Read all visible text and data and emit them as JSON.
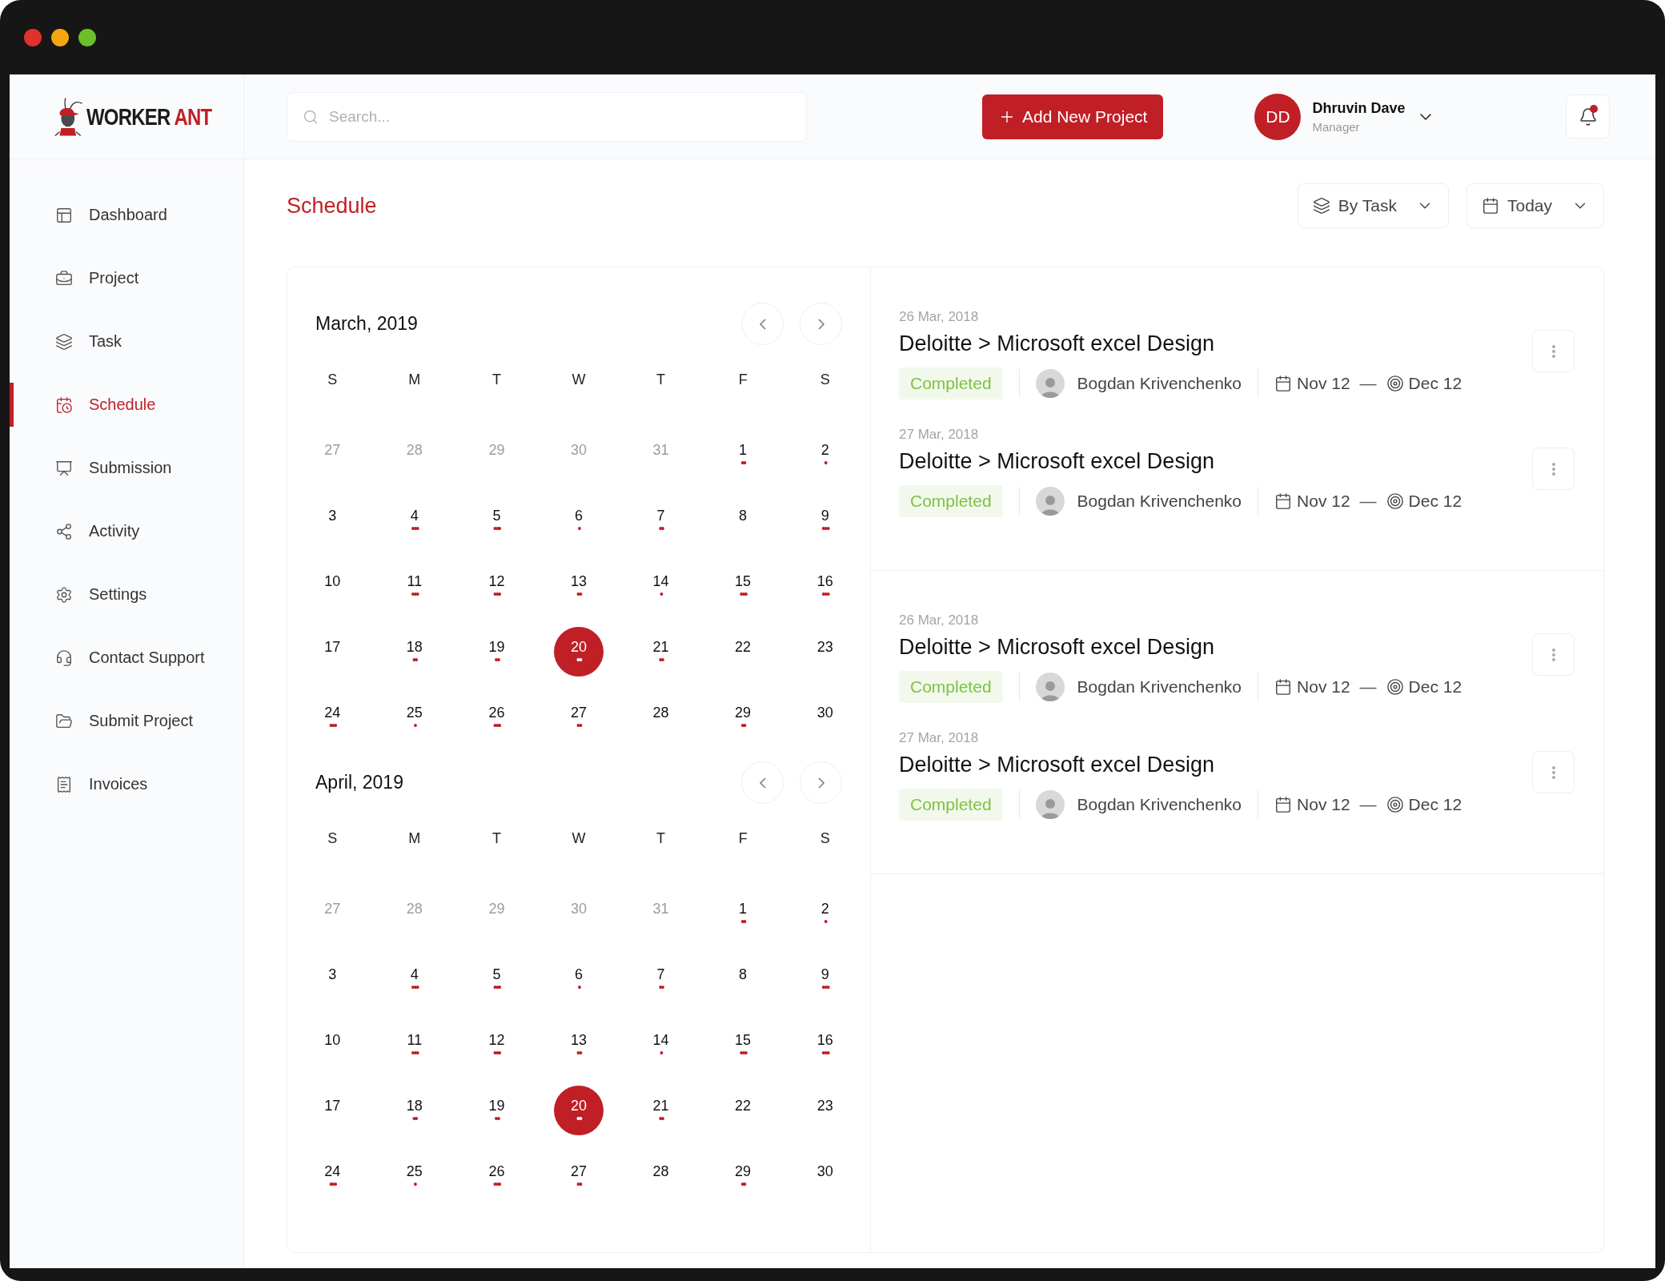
{
  "brand": {
    "word_1": "WORKER",
    "word_2": "ANT"
  },
  "search": {
    "placeholder": "Search..."
  },
  "add_button": {
    "label": "Add New Project"
  },
  "user": {
    "initials": "DD",
    "name": "Dhruvin Dave",
    "role": "Manager"
  },
  "notifications": {
    "unread": true
  },
  "sidebar": {
    "items": [
      {
        "label": "Dashboard",
        "selected": false
      },
      {
        "label": "Project",
        "selected": false
      },
      {
        "label": "Task",
        "selected": false
      },
      {
        "label": "Schedule",
        "selected": true
      },
      {
        "label": "Submission",
        "selected": false
      },
      {
        "label": "Activity",
        "selected": false
      },
      {
        "label": "Settings",
        "selected": false
      },
      {
        "label": "Contact Support",
        "selected": false
      },
      {
        "label": "Submit Project",
        "selected": false
      },
      {
        "label": "Invoices",
        "selected": false
      }
    ]
  },
  "page": {
    "title": "Schedule",
    "filters": [
      {
        "label": "By Task"
      },
      {
        "label": "Today"
      }
    ]
  },
  "calendars": [
    {
      "title": "March, 2019",
      "weekdays": [
        "S",
        "M",
        "T",
        "W",
        "T",
        "F",
        "S"
      ],
      "days": [
        {
          "day": "27",
          "muted": true,
          "selected": false
        },
        {
          "day": "28",
          "muted": true,
          "selected": false
        },
        {
          "day": "29",
          "muted": true,
          "selected": false
        },
        {
          "day": "30",
          "muted": true,
          "selected": false
        },
        {
          "day": "31",
          "muted": true,
          "selected": false
        },
        {
          "day": "1",
          "muted": false,
          "selected": false,
          "dots": "••"
        },
        {
          "day": "2",
          "muted": false,
          "selected": false,
          "dots": "•"
        },
        {
          "day": "3",
          "muted": false,
          "selected": false
        },
        {
          "day": "4",
          "muted": false,
          "selected": false,
          "dots": "•••"
        },
        {
          "day": "5",
          "muted": false,
          "selected": false,
          "dots": "•••"
        },
        {
          "day": "6",
          "muted": false,
          "selected": false,
          "dots": "•"
        },
        {
          "day": "7",
          "muted": false,
          "selected": false,
          "dots": "••"
        },
        {
          "day": "8",
          "muted": false,
          "selected": false
        },
        {
          "day": "9",
          "muted": false,
          "selected": false,
          "dots": "•••"
        },
        {
          "day": "10",
          "muted": false,
          "selected": false
        },
        {
          "day": "11",
          "muted": false,
          "selected": false,
          "dots": "•••"
        },
        {
          "day": "12",
          "muted": false,
          "selected": false,
          "dots": "•••"
        },
        {
          "day": "13",
          "muted": false,
          "selected": false,
          "dots": "••"
        },
        {
          "day": "14",
          "muted": false,
          "selected": false,
          "dots": "•"
        },
        {
          "day": "15",
          "muted": false,
          "selected": false,
          "dots": "•••"
        },
        {
          "day": "16",
          "muted": false,
          "selected": false,
          "dots": "•••"
        },
        {
          "day": "17",
          "muted": false,
          "selected": false
        },
        {
          "day": "18",
          "muted": false,
          "selected": false,
          "dots": "••"
        },
        {
          "day": "19",
          "muted": false,
          "selected": false,
          "dots": "••"
        },
        {
          "day": "20",
          "muted": false,
          "selected": true,
          "dots": "••"
        },
        {
          "day": "21",
          "muted": false,
          "selected": false,
          "dots": "••"
        },
        {
          "day": "22",
          "muted": false,
          "selected": false
        },
        {
          "day": "23",
          "muted": false,
          "selected": false
        },
        {
          "day": "24",
          "muted": false,
          "selected": false,
          "dots": "•••"
        },
        {
          "day": "25",
          "muted": false,
          "selected": false,
          "dots": "•"
        },
        {
          "day": "26",
          "muted": false,
          "selected": false,
          "dots": "•••"
        },
        {
          "day": "27",
          "muted": false,
          "selected": false,
          "dots": "••"
        },
        {
          "day": "28",
          "muted": false,
          "selected": false
        },
        {
          "day": "29",
          "muted": false,
          "selected": false,
          "dots": "••"
        },
        {
          "day": "30",
          "muted": false,
          "selected": false
        }
      ]
    },
    {
      "title": "April, 2019",
      "weekdays": [
        "S",
        "M",
        "T",
        "W",
        "T",
        "F",
        "S"
      ],
      "days": [
        {
          "day": "27",
          "muted": true,
          "selected": false
        },
        {
          "day": "28",
          "muted": true,
          "selected": false
        },
        {
          "day": "29",
          "muted": true,
          "selected": false
        },
        {
          "day": "30",
          "muted": true,
          "selected": false
        },
        {
          "day": "31",
          "muted": true,
          "selected": false
        },
        {
          "day": "1",
          "muted": false,
          "selected": false,
          "dots": "••"
        },
        {
          "day": "2",
          "muted": false,
          "selected": false,
          "dots": "•"
        },
        {
          "day": "3",
          "muted": false,
          "selected": false
        },
        {
          "day": "4",
          "muted": false,
          "selected": false,
          "dots": "•••"
        },
        {
          "day": "5",
          "muted": false,
          "selected": false,
          "dots": "•••"
        },
        {
          "day": "6",
          "muted": false,
          "selected": false,
          "dots": "•"
        },
        {
          "day": "7",
          "muted": false,
          "selected": false,
          "dots": "••"
        },
        {
          "day": "8",
          "muted": false,
          "selected": false
        },
        {
          "day": "9",
          "muted": false,
          "selected": false,
          "dots": "•••"
        },
        {
          "day": "10",
          "muted": false,
          "selected": false
        },
        {
          "day": "11",
          "muted": false,
          "selected": false,
          "dots": "•••"
        },
        {
          "day": "12",
          "muted": false,
          "selected": false,
          "dots": "•••"
        },
        {
          "day": "13",
          "muted": false,
          "selected": false,
          "dots": "••"
        },
        {
          "day": "14",
          "muted": false,
          "selected": false,
          "dots": "•"
        },
        {
          "day": "15",
          "muted": false,
          "selected": false,
          "dots": "•••"
        },
        {
          "day": "16",
          "muted": false,
          "selected": false,
          "dots": "•••"
        },
        {
          "day": "17",
          "muted": false,
          "selected": false
        },
        {
          "day": "18",
          "muted": false,
          "selected": false,
          "dots": "••"
        },
        {
          "day": "19",
          "muted": false,
          "selected": false,
          "dots": "••"
        },
        {
          "day": "20",
          "muted": false,
          "selected": true,
          "dots": "••"
        },
        {
          "day": "21",
          "muted": false,
          "selected": false,
          "dots": "••"
        },
        {
          "day": "22",
          "muted": false,
          "selected": false
        },
        {
          "day": "23",
          "muted": false,
          "selected": false
        },
        {
          "day": "24",
          "muted": false,
          "selected": false,
          "dots": "•••"
        },
        {
          "day": "25",
          "muted": false,
          "selected": false,
          "dots": "•"
        },
        {
          "day": "26",
          "muted": false,
          "selected": false,
          "dots": "•••"
        },
        {
          "day": "27",
          "muted": false,
          "selected": false,
          "dots": "••"
        },
        {
          "day": "28",
          "muted": false,
          "selected": false
        },
        {
          "day": "29",
          "muted": false,
          "selected": false,
          "dots": "••"
        },
        {
          "day": "30",
          "muted": false,
          "selected": false
        }
      ]
    }
  ],
  "task_groups": [
    {
      "tasks": [
        {
          "date": "26 Mar, 2018",
          "title": "Deloitte > Microsoft excel Design",
          "status": "Completed",
          "assignee": "Bogdan Krivenchenko",
          "start": "Nov 12",
          "separator": "—",
          "end": "Dec 12"
        },
        {
          "date": "27 Mar, 2018",
          "title": "Deloitte > Microsoft excel Design",
          "status": "Completed",
          "assignee": "Bogdan Krivenchenko",
          "start": "Nov 12",
          "separator": "—",
          "end": "Dec 12"
        }
      ]
    },
    {
      "tasks": [
        {
          "date": "26 Mar, 2018",
          "title": "Deloitte > Microsoft excel Design",
          "status": "Completed",
          "assignee": "Bogdan Krivenchenko",
          "start": "Nov 12",
          "separator": "—",
          "end": "Dec 12"
        },
        {
          "date": "27 Mar, 2018",
          "title": "Deloitte > Microsoft excel Design",
          "status": "Completed",
          "assignee": "Bogdan Krivenchenko",
          "start": "Nov 12",
          "separator": "—",
          "end": "Dec 12"
        }
      ]
    }
  ]
}
